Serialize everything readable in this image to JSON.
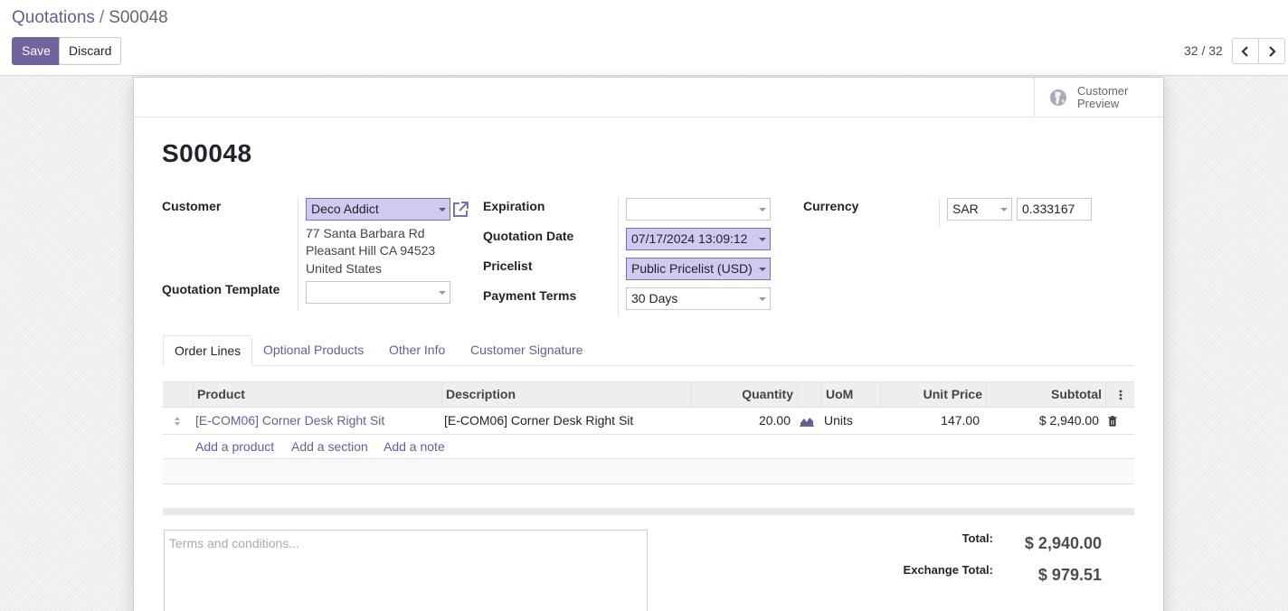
{
  "breadcrumb": {
    "parent": "Quotations",
    "separator": "/",
    "current": "S00048"
  },
  "toolbar": {
    "save_label": "Save",
    "discard_label": "Discard"
  },
  "pager": {
    "value": "32 / 32"
  },
  "button_box": {
    "customer_preview_line1": "Customer",
    "customer_preview_line2": "Preview"
  },
  "record": {
    "name": "S00048",
    "labels": {
      "customer": "Customer",
      "quotation_template": "Quotation Template",
      "expiration": "Expiration",
      "quotation_date": "Quotation Date",
      "pricelist": "Pricelist",
      "payment_terms": "Payment Terms",
      "currency": "Currency"
    },
    "customer": "Deco Addict",
    "address": [
      "77 Santa Barbara Rd",
      "Pleasant Hill CA 94523",
      "United States"
    ],
    "quotation_template": "",
    "expiration": "",
    "quotation_date": "07/17/2024 13:09:12",
    "pricelist": "Public Pricelist (USD)",
    "payment_terms": "30 Days",
    "currency": "SAR",
    "currency_rate": "0.333167"
  },
  "tabs": [
    {
      "label": "Order Lines",
      "active": true
    },
    {
      "label": "Optional Products",
      "active": false
    },
    {
      "label": "Other Info",
      "active": false
    },
    {
      "label": "Customer Signature",
      "active": false
    }
  ],
  "order_lines": {
    "columns": {
      "product": "Product",
      "description": "Description",
      "quantity": "Quantity",
      "uom": "UoM",
      "unit_price": "Unit Price",
      "subtotal": "Subtotal"
    },
    "rows": [
      {
        "product": "[E-COM06] Corner Desk Right Sit",
        "description": "[E-COM06] Corner Desk Right Sit",
        "quantity": "20.00",
        "uom": "Units",
        "unit_price": "147.00",
        "subtotal": "$ 2,940.00"
      }
    ],
    "add_product": "Add a product",
    "add_section": "Add a section",
    "add_note": "Add a note"
  },
  "terms": {
    "placeholder": "Terms and conditions..."
  },
  "totals": {
    "total_label": "Total:",
    "total_value": "$ 2,940.00",
    "exchange_label": "Exchange Total:",
    "exchange_value": "$ 979.51"
  },
  "colors": {
    "primary": "#71639e",
    "link": "#6b5b95",
    "highlight": "#d1c9f0"
  }
}
